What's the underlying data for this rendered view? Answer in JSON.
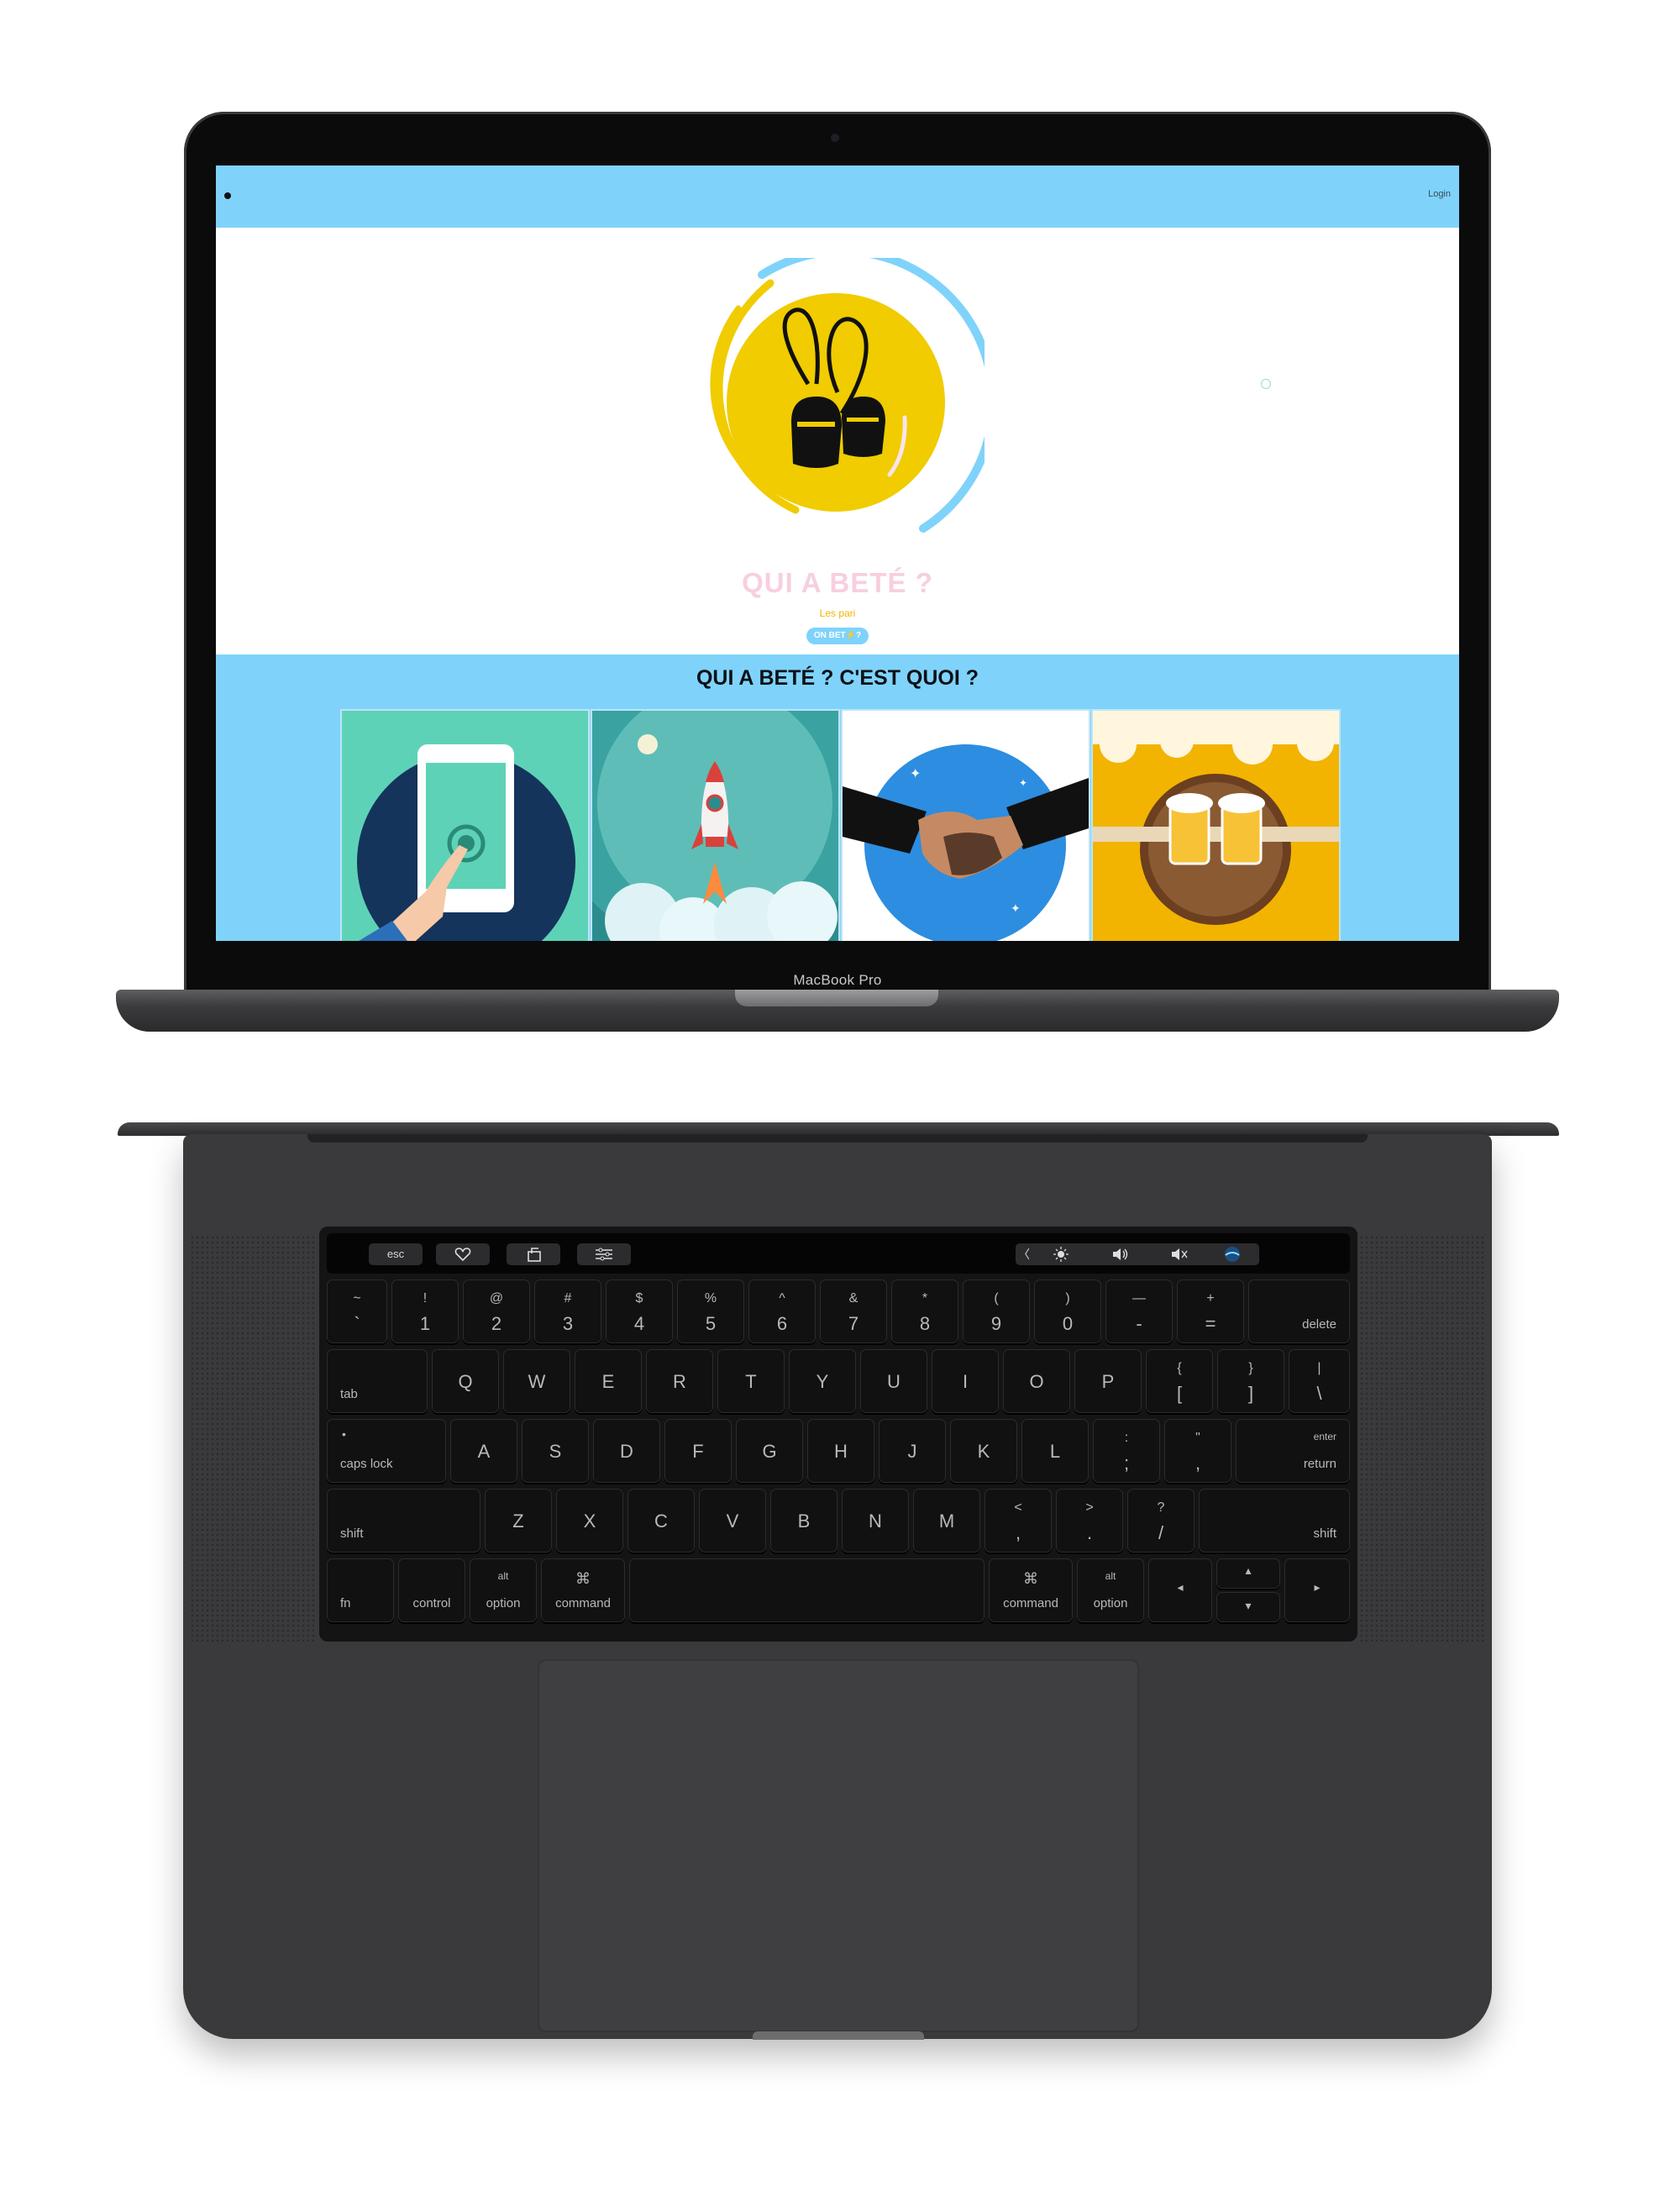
{
  "laptop": {
    "model_label": "MacBook Pro"
  },
  "website": {
    "nav": {
      "login": "Login"
    },
    "hero": {
      "title": "QUI A BETÉ ?",
      "subtitle": "Les pari",
      "cta": "ON BET⚡?"
    },
    "section": {
      "title": "QUI A BETÉ ? C'EST QUOI ?",
      "cards": [
        {
          "icon": "phone-tap-illustration"
        },
        {
          "icon": "rocket-illustration"
        },
        {
          "icon": "handshake-illustration"
        },
        {
          "icon": "beer-toast-illustration"
        }
      ]
    },
    "colors": {
      "nav": "#7fd3fb",
      "title": "#f7cfe0",
      "accent": "#f2b400",
      "logo_circle": "#f0cc00"
    }
  },
  "touchbar": {
    "esc": "esc",
    "left_icons": [
      "heart-icon",
      "share-icon",
      "sliders-icon"
    ],
    "right_icons": [
      "chevron-left-icon",
      "brightness-icon",
      "volume-icon",
      "mute-icon",
      "siri-icon"
    ]
  },
  "keyboard": {
    "row1": [
      {
        "top": "~",
        "bot": "`"
      },
      {
        "top": "!",
        "bot": "1"
      },
      {
        "top": "@",
        "bot": "2"
      },
      {
        "top": "#",
        "bot": "3"
      },
      {
        "top": "$",
        "bot": "4"
      },
      {
        "top": "%",
        "bot": "5"
      },
      {
        "top": "^",
        "bot": "6"
      },
      {
        "top": "&",
        "bot": "7"
      },
      {
        "top": "*",
        "bot": "8"
      },
      {
        "top": "(",
        "bot": "9"
      },
      {
        "top": ")",
        "bot": "0"
      },
      {
        "top": "—",
        "bot": "-"
      },
      {
        "top": "+",
        "bot": "="
      }
    ],
    "delete": "delete",
    "tab": "tab",
    "row2": [
      "Q",
      "W",
      "E",
      "R",
      "T",
      "Y",
      "U",
      "I",
      "O",
      "P"
    ],
    "row2_sym": [
      {
        "top": "{",
        "bot": "["
      },
      {
        "top": "}",
        "bot": "]"
      },
      {
        "top": "|",
        "bot": "\\"
      }
    ],
    "caps": "caps lock",
    "row3": [
      "A",
      "S",
      "D",
      "F",
      "G",
      "H",
      "J",
      "K",
      "L"
    ],
    "row3_sym": [
      {
        "top": ":",
        "bot": ";"
      },
      {
        "top": "\"",
        "bot": ","
      }
    ],
    "enter": "enter",
    "return": "return",
    "shift": "shift",
    "row4": [
      "Z",
      "X",
      "C",
      "V",
      "B",
      "N",
      "M"
    ],
    "row4_sym": [
      {
        "top": "<",
        "bot": ","
      },
      {
        "top": ">",
        "bot": "."
      },
      {
        "top": "?",
        "bot": "/"
      }
    ],
    "fn": "fn",
    "control": "control",
    "alt": "alt",
    "option": "option",
    "cmd_symbol": "⌘",
    "command": "command",
    "arrows": {
      "left": "◂",
      "up": "▴",
      "down": "▾",
      "right": "▸"
    }
  }
}
